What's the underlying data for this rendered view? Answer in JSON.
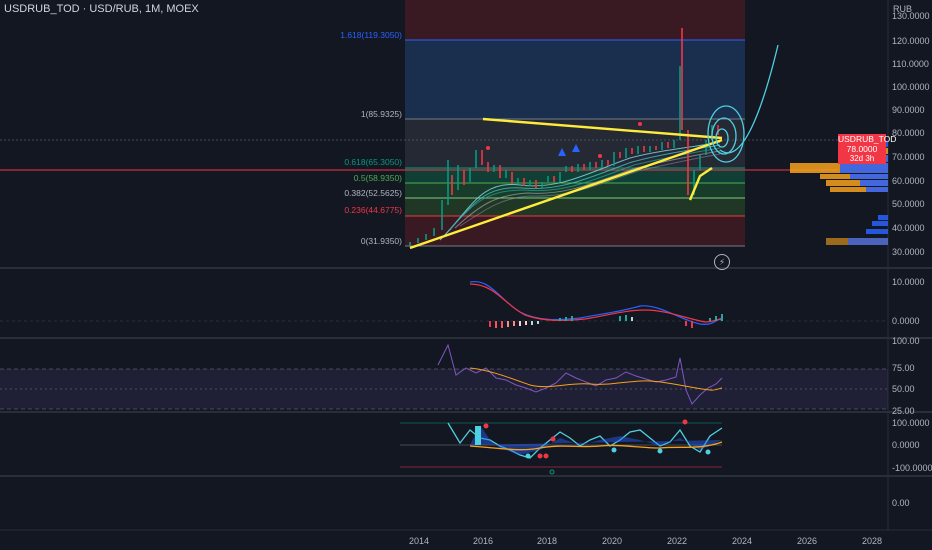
{
  "header": {
    "symbol_line": "USDRUB_TOD · USD/RUB, 1M, MOEX",
    "currency": "RUB"
  },
  "price_axis": {
    "labels": [
      "130.0000",
      "120.0000",
      "110.0000",
      "100.0000",
      "90.0000",
      "80.0000",
      "70.0000",
      "60.0000",
      "50.0000",
      "40.0000",
      "30.0000"
    ]
  },
  "current_price": {
    "symbol": "USDRUB_TOD",
    "value": "78.0000",
    "countdown": "32d 3h"
  },
  "fib_levels": [
    {
      "label": "1.618(119.3050)",
      "color": "#2962ff"
    },
    {
      "label": "1(85.9325)",
      "color": "#787b86"
    },
    {
      "label": "0.618(65.3050)",
      "color": "#089981"
    },
    {
      "label": "0.5(58.9350)",
      "color": "#4caf50"
    },
    {
      "label": "0.382(52.5625)",
      "color": "#81c784"
    },
    {
      "label": "0.236(44.6775)",
      "color": "#f23645"
    },
    {
      "label": "0(31.9350)",
      "color": "#787b86"
    }
  ],
  "macd_axis": {
    "labels": [
      "10.0000",
      "0.0000"
    ]
  },
  "rsi_axis": {
    "labels": [
      "100.00",
      "75.00",
      "50.00",
      "25.00"
    ]
  },
  "osc_axis": {
    "labels": [
      "100.0000",
      "0.0000",
      "-100.0000"
    ]
  },
  "bottom_axis": {
    "labels": [
      "0.00"
    ]
  },
  "time_axis": {
    "labels": [
      "2014",
      "2016",
      "2018",
      "2020",
      "2022",
      "2024",
      "2026",
      "2028"
    ]
  },
  "colors": {
    "background": "#131722",
    "up": "#089981",
    "down": "#f23645",
    "trendline": "#ffeb3b",
    "projection": "#4dd0e1",
    "accent": "#2962ff"
  },
  "icons": {
    "replay": "lightning-icon"
  }
}
